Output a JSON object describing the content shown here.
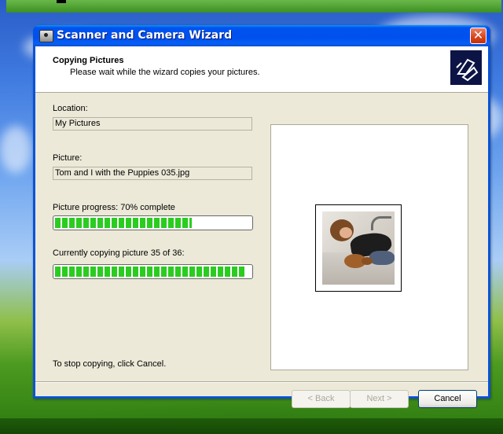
{
  "window": {
    "title": "Scanner and Camera Wizard",
    "close_glyph": "✕"
  },
  "header": {
    "title": "Copying Pictures",
    "subtitle": "Please wait while the wizard copies your pictures.",
    "icon": "scanner-camera-wizard-icon"
  },
  "location": {
    "label": "Location:",
    "value": "My Pictures"
  },
  "picture": {
    "label": "Picture:",
    "value": "Tom and I with the Puppies 035.jpg"
  },
  "picture_progress": {
    "label": "Picture progress: 70% complete",
    "fraction": 0.7
  },
  "overall_progress": {
    "label": "Currently copying picture 35 of 36:",
    "fraction": 0.972
  },
  "stop_hint": "To stop copying, click Cancel.",
  "buttons": {
    "back": "< Back",
    "next": "Next >",
    "cancel": "Cancel"
  },
  "colors": {
    "title_bar": "#0053ee",
    "progress": "#2bcc20",
    "client": "#ece9d8",
    "close": "#d8431b"
  }
}
